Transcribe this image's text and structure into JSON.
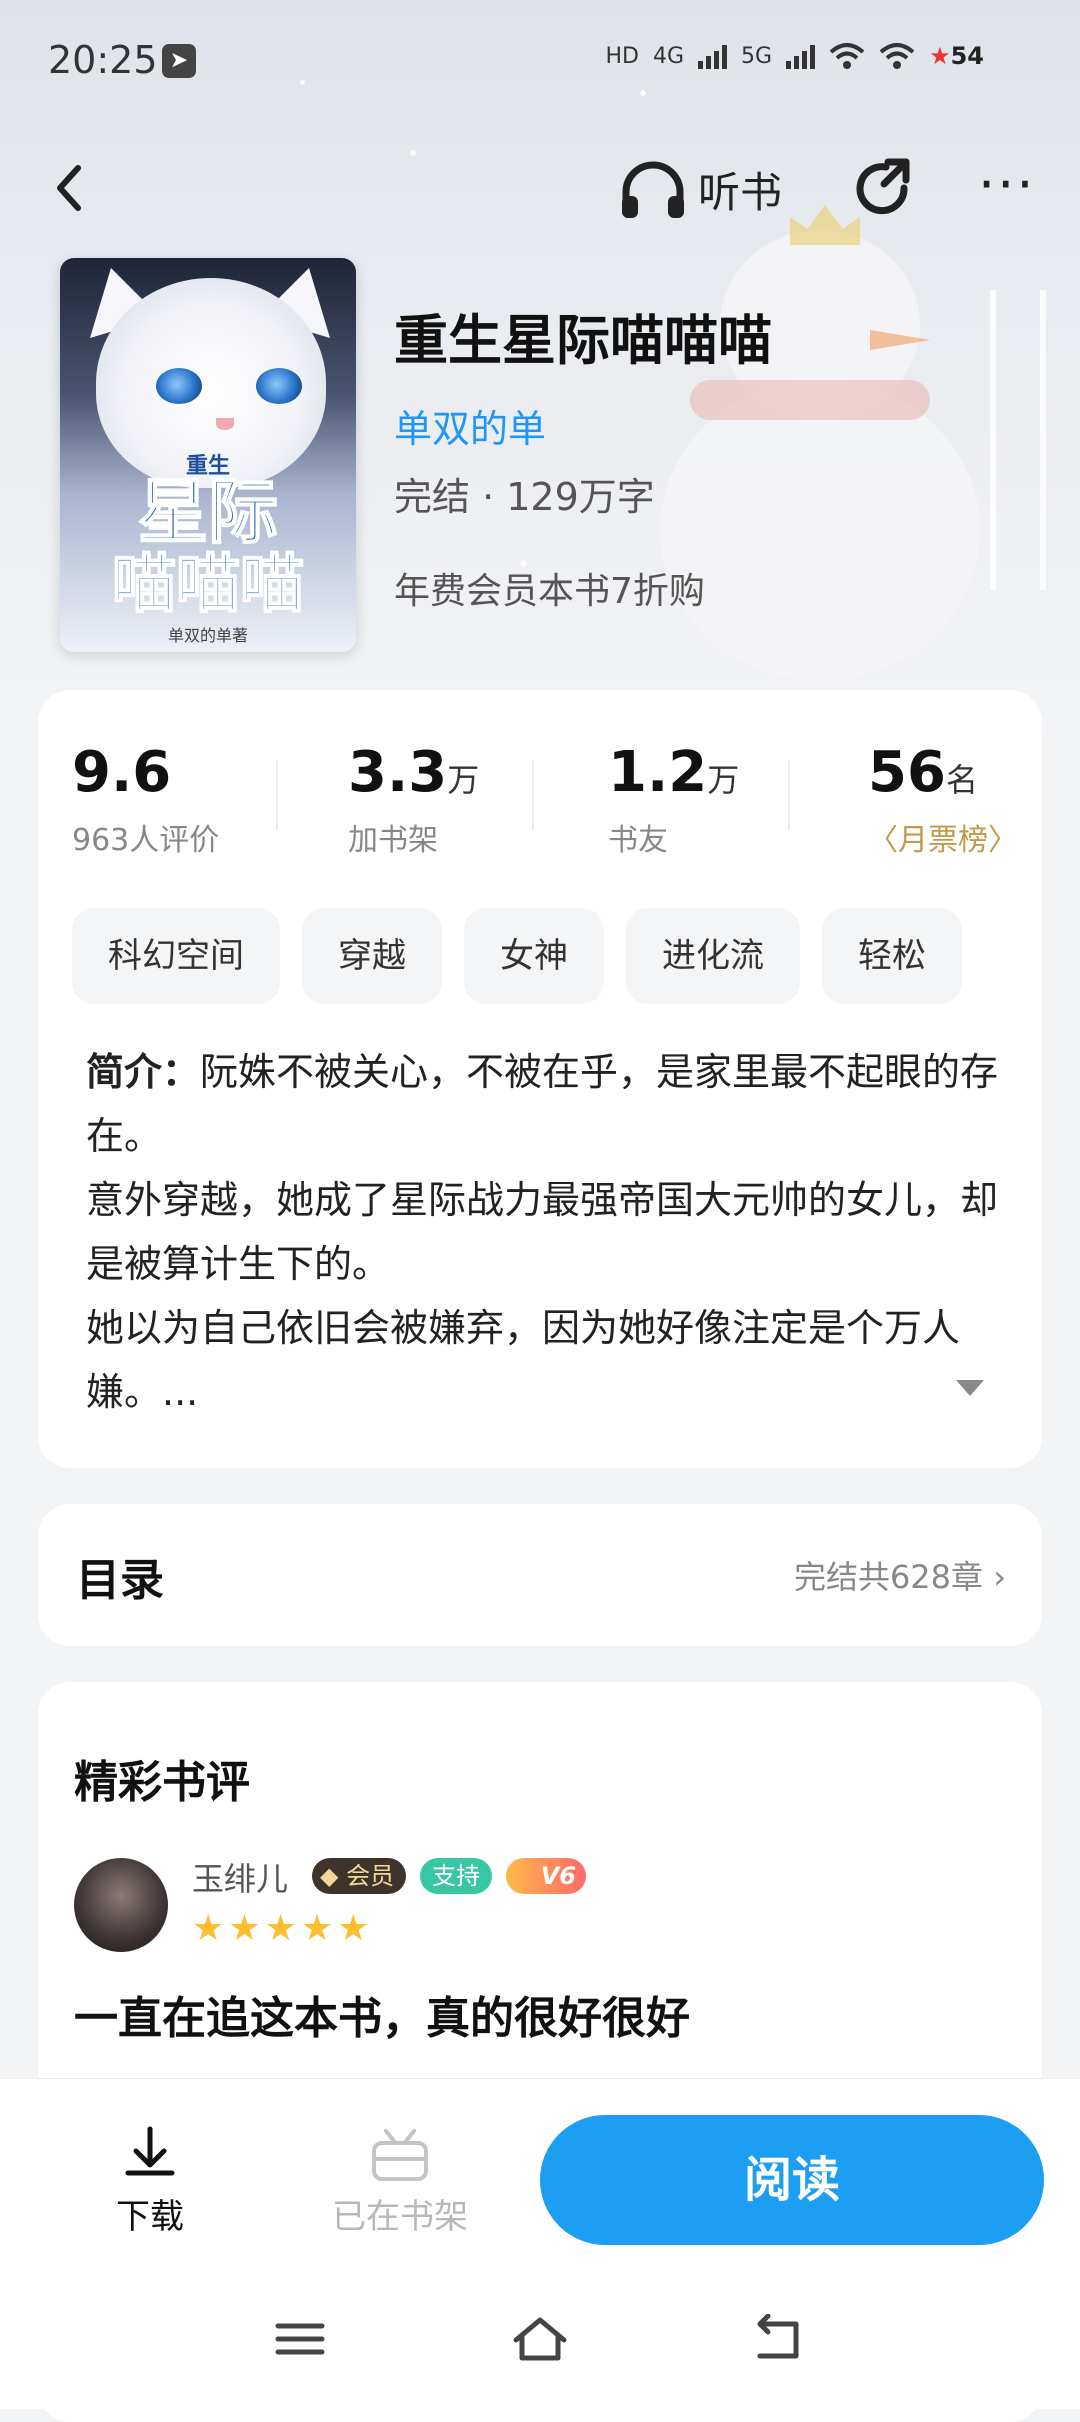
{
  "status_bar": {
    "time": "20:25",
    "network_labels": [
      "HD",
      "4G",
      "5G"
    ],
    "battery": "54"
  },
  "top_nav": {
    "back_icon": "chevron-left-icon",
    "listen_label": "听书",
    "share_icon": "share-icon",
    "more_icon": "more-icon"
  },
  "cover": {
    "subtitle": "重生",
    "title_line1": "星际",
    "title_line2": "喵喵喵",
    "author_sign": "单双的单著"
  },
  "book": {
    "title": "重生星际喵喵喵",
    "author": "单双的单",
    "meta": "完结 · 129万字",
    "promo": "年费会员本书7折购"
  },
  "stats": [
    {
      "value": "9.6",
      "unit": "",
      "label": "963人评价"
    },
    {
      "value": "3.3",
      "unit": "万",
      "label": "加书架"
    },
    {
      "value": "1.2",
      "unit": "万",
      "label": "书友"
    },
    {
      "value": "56",
      "unit": "名",
      "label": "月票榜"
    }
  ],
  "tags": [
    "科幻空间",
    "穿越",
    "女神",
    "进化流",
    "轻松"
  ],
  "intro": {
    "label": "简介：",
    "line1": "阮姝不被关心，不被在乎，是家里最不起眼的存在。",
    "line2": "意外穿越，她成了星际战力最强帝国大元帅的女儿，却是被算计生下的。",
    "line3": "她以为自己依旧会被嫌弃，因为她好像注定是个万人嫌。..."
  },
  "toc": {
    "title": "目录",
    "info": "完结共628章"
  },
  "reviews": {
    "title": "精彩书评",
    "items": [
      {
        "name": "玉绯儿",
        "badge_member": "会员",
        "badge_support": "支持",
        "badge_level": "V6",
        "rating": 5,
        "stars": "★★★★★",
        "text": "一直在追这本书，真的很好很好"
      }
    ]
  },
  "bottom_bar": {
    "download_label": "下载",
    "shelf_label": "已在书架",
    "read_label": "阅读"
  },
  "colors": {
    "accent": "#1c9ef3",
    "author": "#2196f3",
    "star": "#ffbe2e"
  }
}
